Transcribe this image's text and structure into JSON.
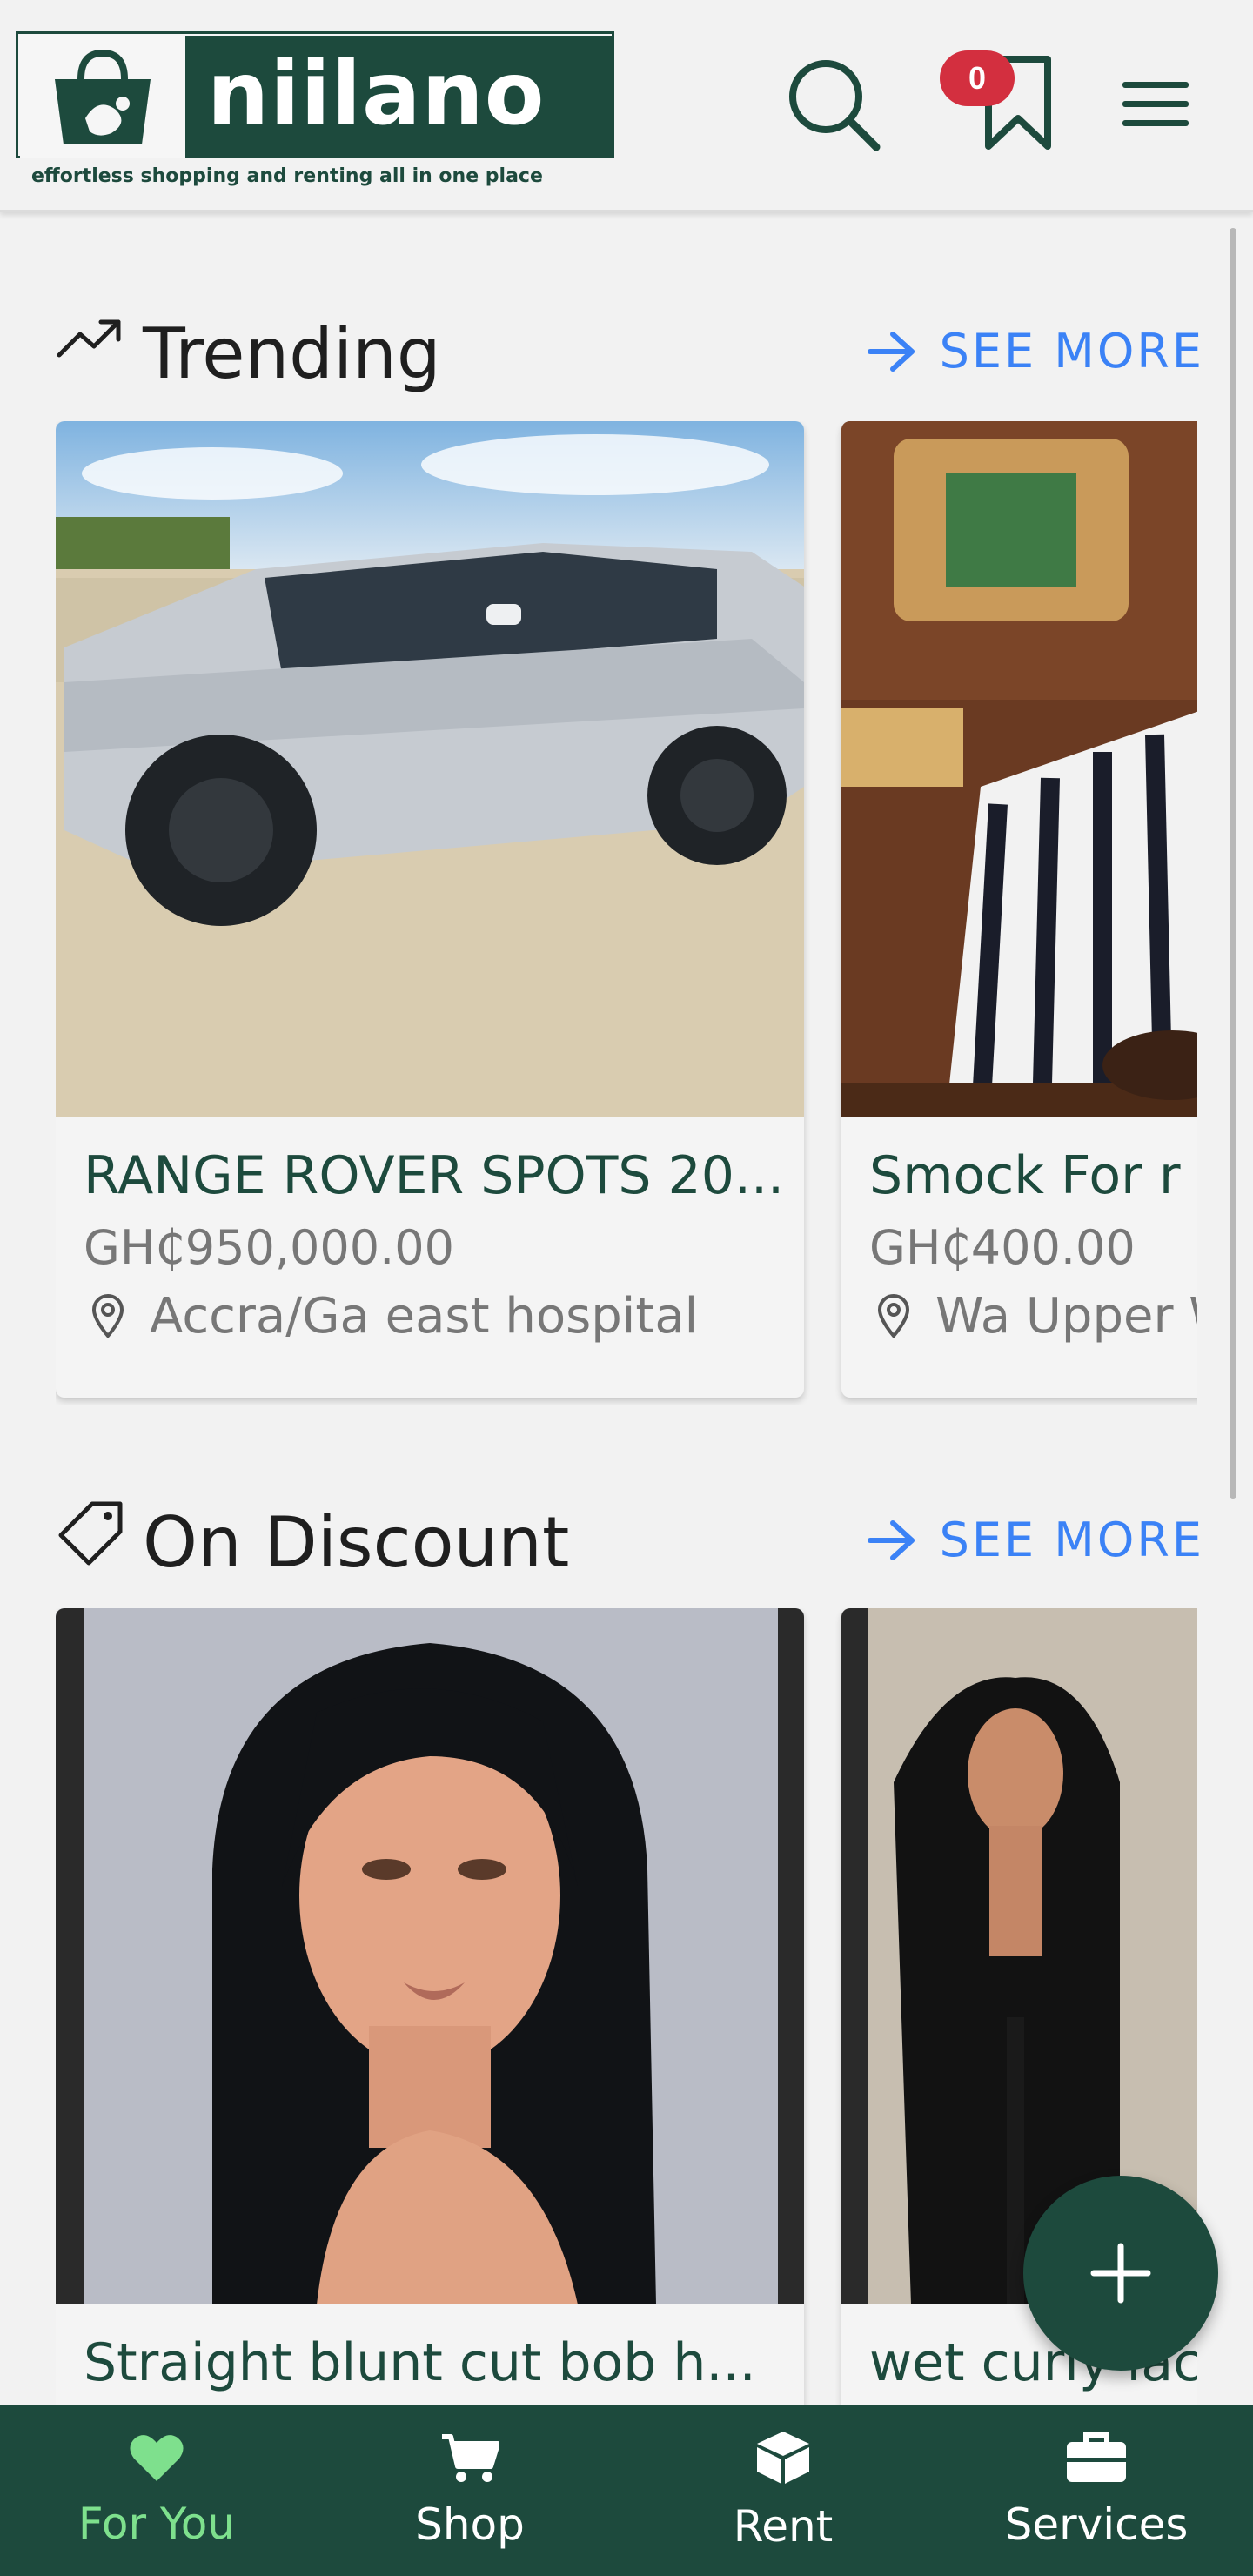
{
  "header": {
    "logo_name": "niilano",
    "logo_tagline": "effortless shopping and renting all in one place",
    "wishlist_count": "0"
  },
  "sections": [
    {
      "title": "Trending",
      "see_more": "SEE MORE",
      "cards": [
        {
          "title": "RANGE ROVER SPOTS 20...",
          "price": "GH₵950,000.00",
          "location": "Accra/Ga east hospital"
        },
        {
          "title": "Smock For r",
          "price": "GH₵400.00",
          "location": "Wa Upper W"
        }
      ]
    },
    {
      "title": "On Discount",
      "see_more": "SEE MORE",
      "cards": [
        {
          "title": "Straight blunt cut bob h..."
        },
        {
          "title": "wet curly lac"
        }
      ]
    }
  ],
  "bottom_nav": [
    {
      "label": "For You",
      "icon": "heart-icon",
      "active": true
    },
    {
      "label": "Shop",
      "icon": "cart-icon",
      "active": false
    },
    {
      "label": "Rent",
      "icon": "box-icon",
      "active": false
    },
    {
      "label": "Services",
      "icon": "briefcase-icon",
      "active": false
    }
  ],
  "colors": {
    "brand": "#1d4a3d",
    "accent_link": "#3b82f6",
    "badge": "#d32f3f",
    "nav_active": "#7ee08d"
  }
}
